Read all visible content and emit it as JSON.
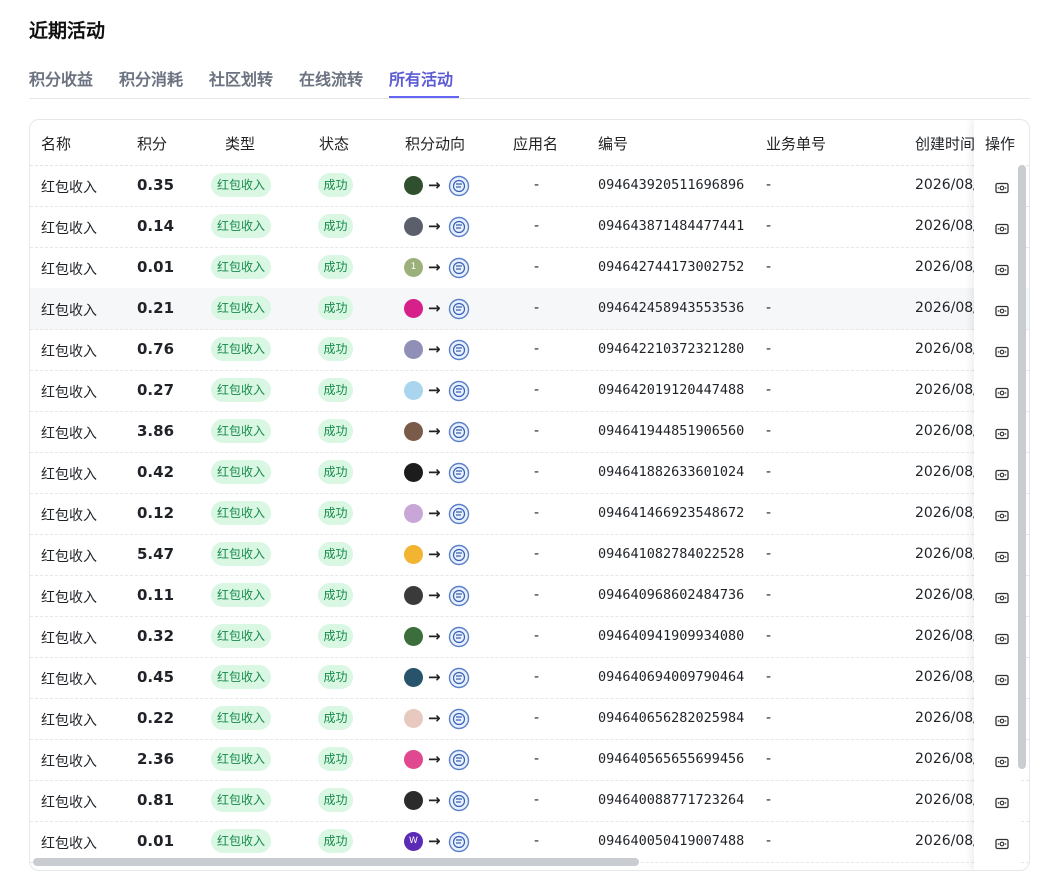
{
  "page": {
    "title": "近期活动"
  },
  "tabs": [
    {
      "label": "积分收益",
      "active": false
    },
    {
      "label": "积分消耗",
      "active": false
    },
    {
      "label": "社区划转",
      "active": false
    },
    {
      "label": "在线流转",
      "active": false
    },
    {
      "label": "所有活动",
      "active": true
    }
  ],
  "table": {
    "headers": {
      "name": "名称",
      "points": "积分",
      "type": "类型",
      "status": "状态",
      "flow": "积分动向",
      "app": "应用名",
      "number": "编号",
      "biz_no": "业务单号",
      "created": "创建时间",
      "action": "操作"
    },
    "rows": [
      {
        "name": "红包收入",
        "points": "0.35",
        "type": "红包收入",
        "status": "成功",
        "avatar_color": "#2f4f2f",
        "avatar_icon": "user-avatar-icon",
        "arrow": "→",
        "app": "-",
        "number": "094643920511696896",
        "biz_no": "-",
        "created": "2026/08/"
      },
      {
        "name": "红包收入",
        "points": "0.14",
        "type": "红包收入",
        "status": "成功",
        "avatar_color": "#5a5f6b",
        "avatar_icon": "user-avatar-icon",
        "arrow": "→",
        "app": "-",
        "number": "094643871484477441",
        "biz_no": "-",
        "created": "2026/08/"
      },
      {
        "name": "红包收入",
        "points": "0.01",
        "type": "红包收入",
        "status": "成功",
        "avatar_color": "#9cb17a",
        "avatar_icon": "user-avatar-icon",
        "avatar_text": "1",
        "arrow": "→",
        "app": "-",
        "number": "094642744173002752",
        "biz_no": "-",
        "created": "2026/08/"
      },
      {
        "name": "红包收入",
        "points": "0.21",
        "type": "红包收入",
        "status": "成功",
        "avatar_color": "#d6218a",
        "avatar_icon": "user-avatar-icon",
        "arrow": "→",
        "app": "-",
        "number": "094642458943553536",
        "biz_no": "-",
        "created": "2026/08/"
      },
      {
        "name": "红包收入",
        "points": "0.76",
        "type": "红包收入",
        "status": "成功",
        "avatar_color": "#8f8fb8",
        "avatar_icon": "user-avatar-icon",
        "arrow": "→",
        "app": "-",
        "number": "094642210372321280",
        "biz_no": "-",
        "created": "2026/08/"
      },
      {
        "name": "红包收入",
        "points": "0.27",
        "type": "红包收入",
        "status": "成功",
        "avatar_color": "#a9d6ee",
        "avatar_icon": "user-avatar-icon",
        "arrow": "→",
        "app": "-",
        "number": "094642019120447488",
        "biz_no": "-",
        "created": "2026/08/"
      },
      {
        "name": "红包收入",
        "points": "3.86",
        "type": "红包收入",
        "status": "成功",
        "avatar_color": "#7a5a48",
        "avatar_icon": "user-avatar-icon",
        "arrow": "→",
        "app": "-",
        "number": "094641944851906560",
        "biz_no": "-",
        "created": "2026/08/"
      },
      {
        "name": "红包收入",
        "points": "0.42",
        "type": "红包收入",
        "status": "成功",
        "avatar_color": "#1c1c1c",
        "avatar_icon": "user-avatar-icon",
        "arrow": "→",
        "app": "-",
        "number": "094641882633601024",
        "biz_no": "-",
        "created": "2026/08/"
      },
      {
        "name": "红包收入",
        "points": "0.12",
        "type": "红包收入",
        "status": "成功",
        "avatar_color": "#c9a6d8",
        "avatar_icon": "user-avatar-icon",
        "arrow": "→",
        "app": "-",
        "number": "094641466923548672",
        "biz_no": "-",
        "created": "2026/08/"
      },
      {
        "name": "红包收入",
        "points": "5.47",
        "type": "红包收入",
        "status": "成功",
        "avatar_color": "#f2b431",
        "avatar_icon": "user-avatar-icon",
        "arrow": "→",
        "app": "-",
        "number": "094641082784022528",
        "biz_no": "-",
        "created": "2026/08/"
      },
      {
        "name": "红包收入",
        "points": "0.11",
        "type": "红包收入",
        "status": "成功",
        "avatar_color": "#3a3a3a",
        "avatar_icon": "user-avatar-icon",
        "arrow": "→",
        "app": "-",
        "number": "094640968602484736",
        "biz_no": "-",
        "created": "2026/08/"
      },
      {
        "name": "红包收入",
        "points": "0.32",
        "type": "红包收入",
        "status": "成功",
        "avatar_color": "#3b6e3b",
        "avatar_icon": "user-avatar-icon",
        "arrow": "→",
        "app": "-",
        "number": "094640941909934080",
        "biz_no": "-",
        "created": "2026/08/"
      },
      {
        "name": "红包收入",
        "points": "0.45",
        "type": "红包收入",
        "status": "成功",
        "avatar_color": "#27536b",
        "avatar_icon": "user-avatar-icon",
        "arrow": "→",
        "app": "-",
        "number": "094640694009790464",
        "biz_no": "-",
        "created": "2026/08/"
      },
      {
        "name": "红包收入",
        "points": "0.22",
        "type": "红包收入",
        "status": "成功",
        "avatar_color": "#e7c9c0",
        "avatar_icon": "user-avatar-icon",
        "arrow": "→",
        "app": "-",
        "number": "094640656282025984",
        "biz_no": "-",
        "created": "2026/08/"
      },
      {
        "name": "红包收入",
        "points": "2.36",
        "type": "红包收入",
        "status": "成功",
        "avatar_color": "#e0488f",
        "avatar_icon": "user-avatar-icon",
        "arrow": "→",
        "app": "-",
        "number": "094640565655699456",
        "biz_no": "-",
        "created": "2026/08/"
      },
      {
        "name": "红包收入",
        "points": "0.81",
        "type": "红包收入",
        "status": "成功",
        "avatar_color": "#2b2b2b",
        "avatar_icon": "user-avatar-icon",
        "arrow": "→",
        "app": "-",
        "number": "094640088771723264",
        "biz_no": "-",
        "created": "2026/08/"
      },
      {
        "name": "红包收入",
        "points": "0.01",
        "type": "红包收入",
        "status": "成功",
        "avatar_color": "#5b2bb5",
        "avatar_icon": "user-avatar-icon",
        "avatar_text": "W",
        "arrow": "→",
        "app": "-",
        "number": "094640050419007488",
        "biz_no": "-",
        "created": "2026/08/"
      }
    ]
  },
  "colors": {
    "accent": "#6366f1",
    "tag_bg": "#d9f7e3",
    "tag_text": "#178a4b"
  },
  "icons": {
    "app_icon": "community-app-icon",
    "action_icon": "view-ticket-icon"
  }
}
